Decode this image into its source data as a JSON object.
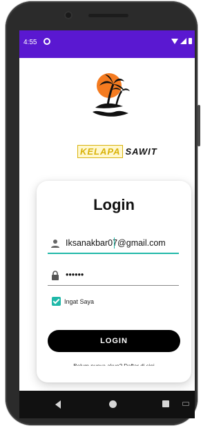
{
  "status_bar": {
    "time": "4:55",
    "background": "#5a18d1"
  },
  "brand": {
    "part1": "KELAPA",
    "part2": "SAWIT",
    "accent": "#d9b20a"
  },
  "login_card": {
    "title": "Login",
    "email_value": "Iksanakbar07@gmail.com",
    "password_masked": "••••••",
    "remember_label": "Ingat Saya",
    "remember_checked": true,
    "login_button_label": "LOGIN",
    "register_hint": "Belum punya akun? Daftar di sini"
  },
  "icons": {
    "user": "person-icon",
    "lock": "lock-icon",
    "checkbox": "check-icon"
  },
  "colors": {
    "accent_teal": "#1fb8a8",
    "button_bg": "#000000"
  }
}
